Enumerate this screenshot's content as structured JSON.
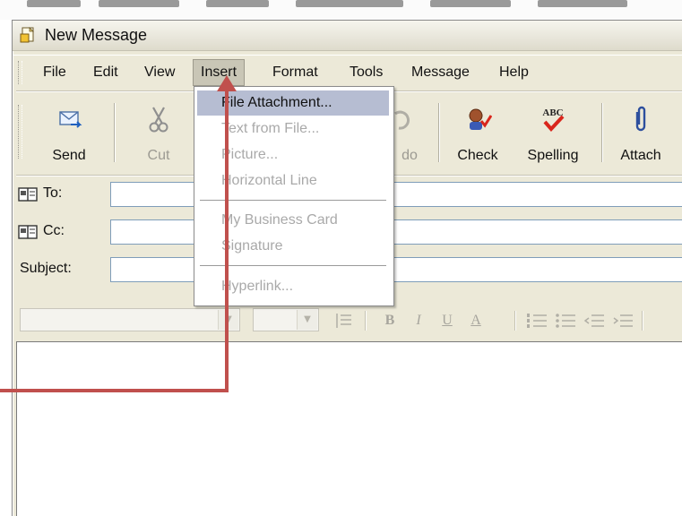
{
  "window": {
    "title": "New Message"
  },
  "menubar": {
    "items": [
      "File",
      "Edit",
      "View",
      "Insert",
      "Format",
      "Tools",
      "Message",
      "Help"
    ],
    "active": "Insert"
  },
  "toolbar": {
    "send": "Send",
    "cut": "Cut",
    "undo_partial": "do",
    "check": "Check",
    "spelling": "Spelling",
    "spelling_icon_text": "ABC",
    "attach": "Attach"
  },
  "fields": {
    "to_label": "To:",
    "cc_label": "Cc:",
    "subject_label": "Subject:"
  },
  "format_toolbar": {
    "bold": "B",
    "italic": "I",
    "underline": "U",
    "font_color": "A"
  },
  "insert_menu": {
    "items": [
      {
        "label": "File Attachment...",
        "enabled": true,
        "highlighted": true
      },
      {
        "label": "Text from File...",
        "enabled": false
      },
      {
        "label": "Picture...",
        "enabled": false
      },
      {
        "label": "Horizontal Line",
        "enabled": false
      },
      {
        "label": "My Business Card",
        "enabled": false
      },
      {
        "label": "Signature",
        "enabled": false
      },
      {
        "label": "Hyperlink...",
        "enabled": false
      }
    ]
  },
  "colors": {
    "annotation_arrow": "#c0504d",
    "menu_highlight": "#b6bdd2",
    "window_bg": "#ece9d8"
  },
  "icons": {
    "title": "new-message-icon",
    "send": "send-mail-icon",
    "cut": "scissors-icon",
    "check": "check-names-icon",
    "spelling": "spell-check-icon",
    "attach": "paperclip-icon",
    "address_book": "address-book-icon"
  }
}
